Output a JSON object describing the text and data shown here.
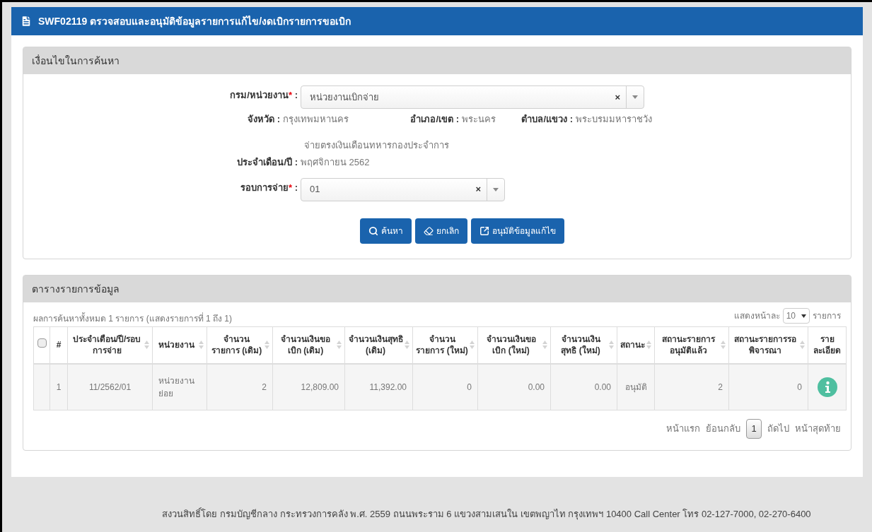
{
  "window": {
    "title": "SWF02119 ตรวจสอบและอนุมัติข้อมูลรายการแก้ไข/งดเบิกรายการขอเบิก"
  },
  "search_panel": {
    "title": "เงื่อนไขในการค้นหา",
    "department": {
      "label": "กรม/หน่วยงาน",
      "required_mark": "*",
      "colon": ":",
      "value": "หน่วยงานเบิกจ่าย",
      "clear": "×"
    },
    "location": [
      {
        "label": "จังหวัด :",
        "value": "กรุงเทพมหานคร"
      },
      {
        "label": "อำเภอ/เขต :",
        "value": "พระนคร"
      },
      {
        "label": "ตำบล/แขวง :",
        "value": "พระบรมมหาราชวัง"
      }
    ],
    "note": "จ่ายตรงเงินเดือนทหารกองประจำการ",
    "period": {
      "label": "ประจำเดือน/ปี :",
      "value": "พฤศจิกายน 2562"
    },
    "round": {
      "label": "รอบการจ่าย",
      "required_mark": "*",
      "colon": ":",
      "value": "01",
      "clear": "×"
    },
    "buttons": [
      {
        "kind": "search",
        "label": "ค้นหา"
      },
      {
        "kind": "clear",
        "label": "ยกเลิก"
      },
      {
        "kind": "approve",
        "label": "อนุมัติข้อมูลแก้ไข"
      }
    ]
  },
  "table_panel": {
    "title": "ตารางรายการข้อมูล",
    "summary": "ผลการค้นหาทั้งหมด 1 รายการ (แสดงรายการที่ 1 ถึง 1)",
    "page_size": {
      "label": "แสดงหน้าละ",
      "value": "10",
      "suffix": "รายการ"
    },
    "select_all": {
      "checked": false
    },
    "columns": [
      {
        "label": "#",
        "sortable": false
      },
      {
        "label": "ประจำเดือน/ปี/รอบการจ่าย",
        "sortable": true
      },
      {
        "label": "หน่วยงาน",
        "sortable": true
      },
      {
        "label": "จำนวนรายการ (เดิม)",
        "sortable": true
      },
      {
        "label": "จำนวนเงินขอเบิก (เดิม)",
        "sortable": true
      },
      {
        "label": "จำนวนเงินสุทธิ (เดิม)",
        "sortable": true
      },
      {
        "label": "จำนวนรายการ (ใหม่)",
        "sortable": true
      },
      {
        "label": "จำนวนเงินขอเบิก (ใหม่)",
        "sortable": true
      },
      {
        "label": "จำนวนเงินสุทธิ (ใหม่)",
        "sortable": true
      },
      {
        "label": "สถานะ",
        "sortable": true
      },
      {
        "label": "สถานะรายการอนุมัติแล้ว",
        "sortable": true
      },
      {
        "label": "สถานะรายการรอพิจารณา",
        "sortable": true
      },
      {
        "label": "รายละเอียด",
        "sortable": false
      }
    ],
    "rows": [
      {
        "cells": [
          "1",
          "11/2562/01",
          "หน่วยงานย่อย",
          "2",
          "12,809.00",
          "11,392.00",
          "0",
          "0.00",
          "0.00",
          "อนุมัติ",
          "2",
          "0"
        ]
      }
    ],
    "pagination": {
      "first": "หน้าแรก",
      "prev": "ย้อนกลับ",
      "pages": [
        {
          "label": "1",
          "selected": true
        }
      ],
      "next": "ถัดไป",
      "last": "หน้าสุดท้าย"
    }
  },
  "footer": "สงวนสิทธิ์โดย กรมบัญชีกลาง กระทรวงการคลัง พ.ศ. 2559 ถนนพระราม 6 แขวงสามเสนใน เขตพญาไท กรุงเทพฯ 10400 Call Center โทร 02-127-7000, 02-270-6400"
}
